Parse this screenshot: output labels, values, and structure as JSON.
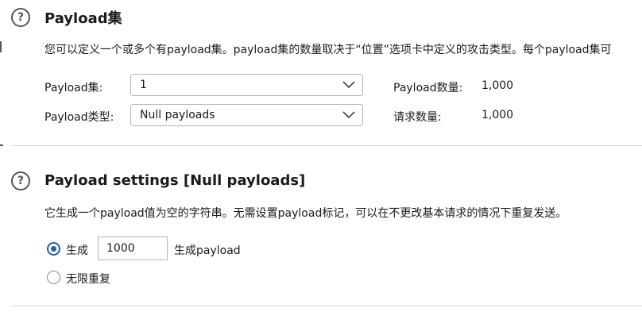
{
  "payload_sets": {
    "title": "Payload集",
    "description": "您可以定义一个或多个有payload集。payload集的数量取决于“位置”选项卡中定义的攻击类型。每个payload集可",
    "set_label": "Payload集:",
    "set_value": "1",
    "type_label": "Payload类型:",
    "type_value": "Null payloads",
    "count_label": "Payload数量:",
    "count_value": "1,000",
    "requests_label": "请求数量:",
    "requests_value": "1,000"
  },
  "payload_settings": {
    "title": "Payload settings [Null payloads]",
    "description": "它生成一个payload值为空的字符串。无需设置payload标记，可以在不更改基本请求的情况下重复发送。",
    "generate_label": "生成",
    "generate_count": "1000",
    "generate_suffix": "生成payload",
    "infinite_label": "无限重复",
    "generate_selected": true
  },
  "icons": {
    "help": "?"
  },
  "colors": {
    "accent": "#1f5fa8",
    "divider": "#d8d8d8"
  }
}
